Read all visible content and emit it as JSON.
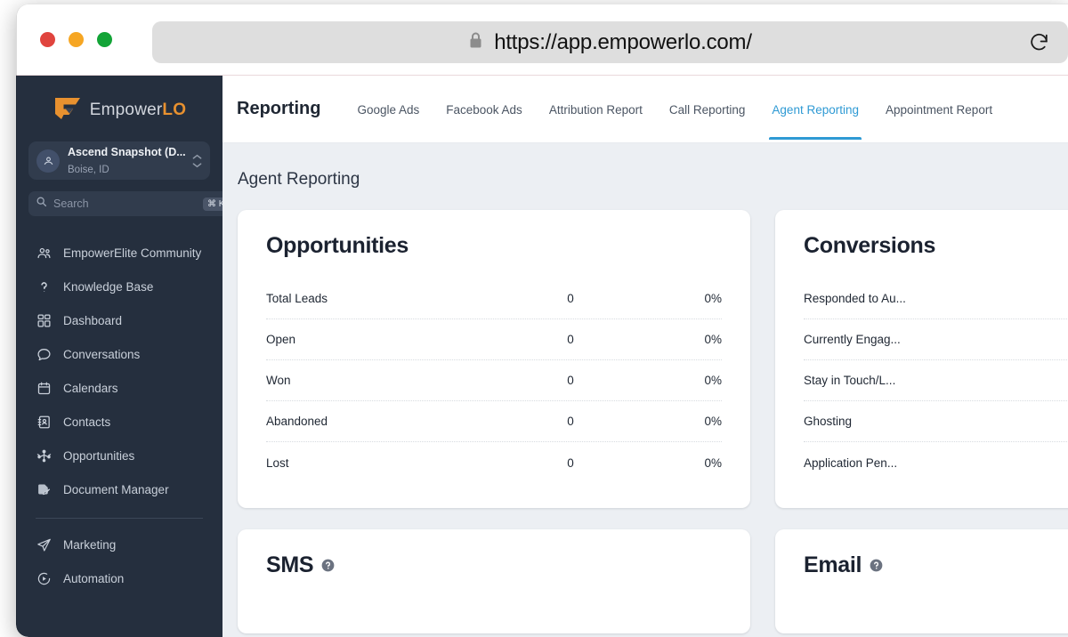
{
  "browser": {
    "url": "https://app.empowerlo.com/",
    "lock_icon": "lock-icon",
    "reload_icon": "reload-icon",
    "traffic_lights": [
      "close",
      "minimize",
      "zoom"
    ],
    "colors": {
      "close": "#e0443e",
      "minimize": "#f6a623",
      "zoom": "#13a437"
    }
  },
  "sidebar": {
    "logo": {
      "name": "Empower",
      "accent": "LO",
      "mark_color": "#e8912f"
    },
    "account": {
      "name": "Ascend Snapshot (D...",
      "location": "Boise, ID",
      "avatar_icon": "location-pin-avatar-icon",
      "switch_icon": "chevron-up-down-icon"
    },
    "search": {
      "placeholder": "Search",
      "value": "",
      "shortcut": "⌘ K",
      "icon": "search-icon"
    },
    "quick_action": {
      "icon": "lightning-bolt-icon",
      "color": "#2ecc8f"
    },
    "items": [
      {
        "label": "EmpowerElite Community",
        "icon": "users-group-icon"
      },
      {
        "label": "Knowledge Base",
        "icon": "question-mark-icon"
      },
      {
        "label": "Dashboard",
        "icon": "dashboard-grid-icon"
      },
      {
        "label": "Conversations",
        "icon": "chat-bubble-icon"
      },
      {
        "label": "Calendars",
        "icon": "calendar-icon"
      },
      {
        "label": "Contacts",
        "icon": "contacts-book-icon"
      },
      {
        "label": "Opportunities",
        "icon": "opportunities-network-icon"
      },
      {
        "label": "Document Manager",
        "icon": "document-edit-icon"
      }
    ],
    "items_secondary": [
      {
        "label": "Marketing",
        "icon": "paper-plane-icon"
      },
      {
        "label": "Automation",
        "icon": "play-circle-icon"
      }
    ]
  },
  "header": {
    "section_title": "Reporting",
    "tabs": [
      {
        "label": "Google Ads",
        "active": false
      },
      {
        "label": "Facebook Ads",
        "active": false
      },
      {
        "label": "Attribution Report",
        "active": false
      },
      {
        "label": "Call Reporting",
        "active": false
      },
      {
        "label": "Agent Reporting",
        "active": true
      },
      {
        "label": "Appointment Report",
        "active": false
      }
    ],
    "active_color": "#2f9ad4"
  },
  "main": {
    "page_title": "Agent Reporting",
    "opportunities": {
      "title": "Opportunities",
      "rows": [
        {
          "label": "Total Leads",
          "value": "0",
          "percent": "0%"
        },
        {
          "label": "Open",
          "value": "0",
          "percent": "0%"
        },
        {
          "label": "Won",
          "value": "0",
          "percent": "0%"
        },
        {
          "label": "Abandoned",
          "value": "0",
          "percent": "0%"
        },
        {
          "label": "Lost",
          "value": "0",
          "percent": "0%"
        }
      ]
    },
    "conversions": {
      "title": "Conversions",
      "rows": [
        {
          "label": "Responded to Au..."
        },
        {
          "label": "Currently Engag..."
        },
        {
          "label": "Stay in Touch/L..."
        },
        {
          "label": "Ghosting"
        },
        {
          "label": "Application Pen..."
        }
      ]
    },
    "sms": {
      "title": "SMS",
      "help_icon": "help-circle-icon"
    },
    "email": {
      "title": "Email",
      "help_icon": "help-circle-icon"
    }
  }
}
